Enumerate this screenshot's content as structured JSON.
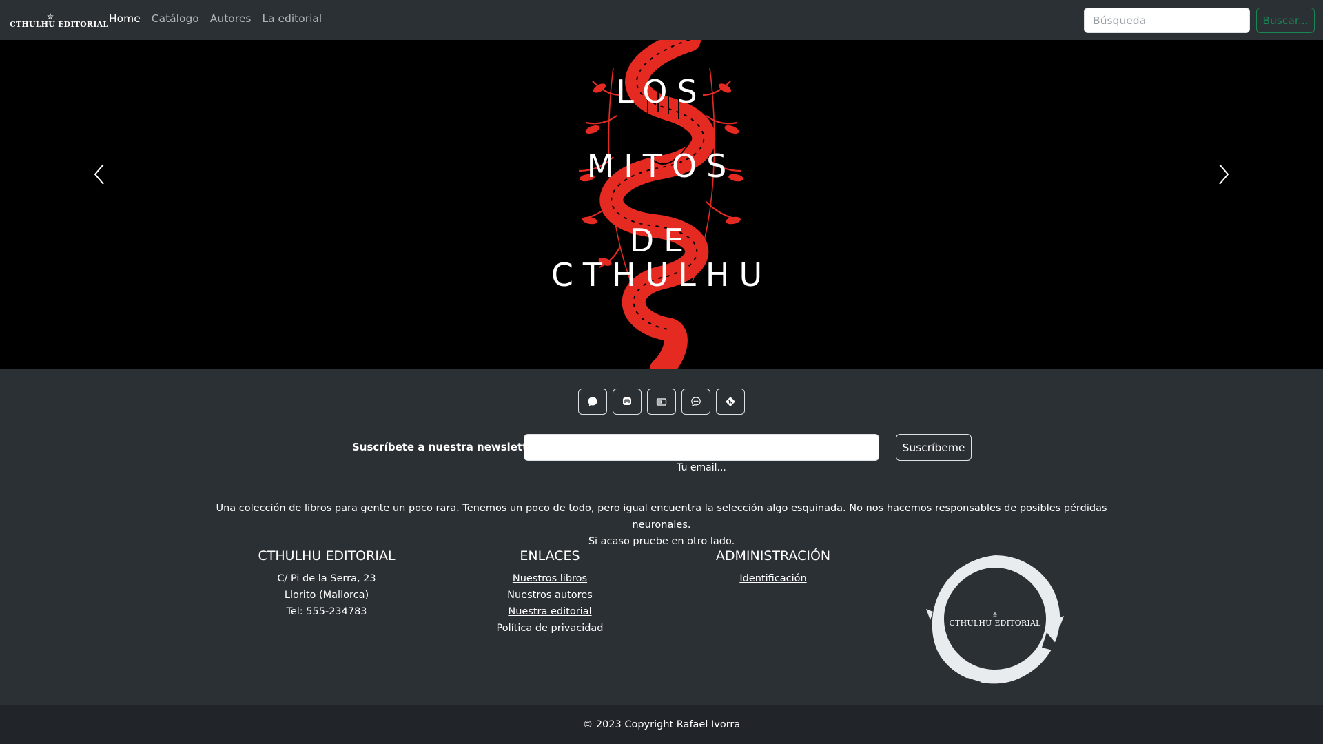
{
  "navbar": {
    "brand": "CTHULHU EDITORIAL",
    "brand_star": "✮",
    "links": [
      {
        "label": "Home",
        "active": true
      },
      {
        "label": "Catálogo",
        "active": false
      },
      {
        "label": "Autores",
        "active": false
      },
      {
        "label": "La editorial",
        "active": false
      }
    ],
    "search_placeholder": "Búsqueda",
    "search_button": "Buscar..."
  },
  "carousel": {
    "slide_title_lines": [
      "LOS",
      "MITOS",
      "DE",
      "CTHULHU"
    ],
    "prev_icon": "chevron-left-icon",
    "next_icon": "chevron-right-icon",
    "art_color": "#e52a22"
  },
  "social_icons": [
    "chat-icon",
    "mastodon-icon",
    "wallet-icon",
    "chat-dots-icon",
    "git-icon"
  ],
  "newsletter": {
    "label": "Suscríbete a nuestra newsletter",
    "hint": "Tu email...",
    "button": "Suscríbeme"
  },
  "description": {
    "line1": "Una colección de libros para gente un poco rara. Tenemos un poco de todo, pero igual encuentra la selección algo esquinada. No nos hacemos responsables de posibles pérdidas neuronales.",
    "line2": "Si acaso pruebe en otro lado."
  },
  "columns": {
    "editorial": {
      "title": "CTHULHU EDITORIAL",
      "lines": [
        "C/ Pi de la Serra, 23",
        "Llorito (Mallorca)",
        "Tel: 555-234783"
      ]
    },
    "enlaces": {
      "title": "ENLACES",
      "links": [
        "Nuestros libros",
        "Nuestros autores",
        "Nuestra editorial",
        "Política de privacidad"
      ]
    },
    "admin": {
      "title": "ADMINISTRACIÓN",
      "links": [
        "Identificación"
      ]
    }
  },
  "seal": {
    "text": "CTHULHU EDITORIAL",
    "star": "✮"
  },
  "footer": {
    "copyright": "© 2023 Copyright Rafael Ivorra"
  },
  "colors": {
    "navbar_bg": "#2b3035",
    "bottom_bar_bg": "#212529",
    "success": "#198754"
  }
}
